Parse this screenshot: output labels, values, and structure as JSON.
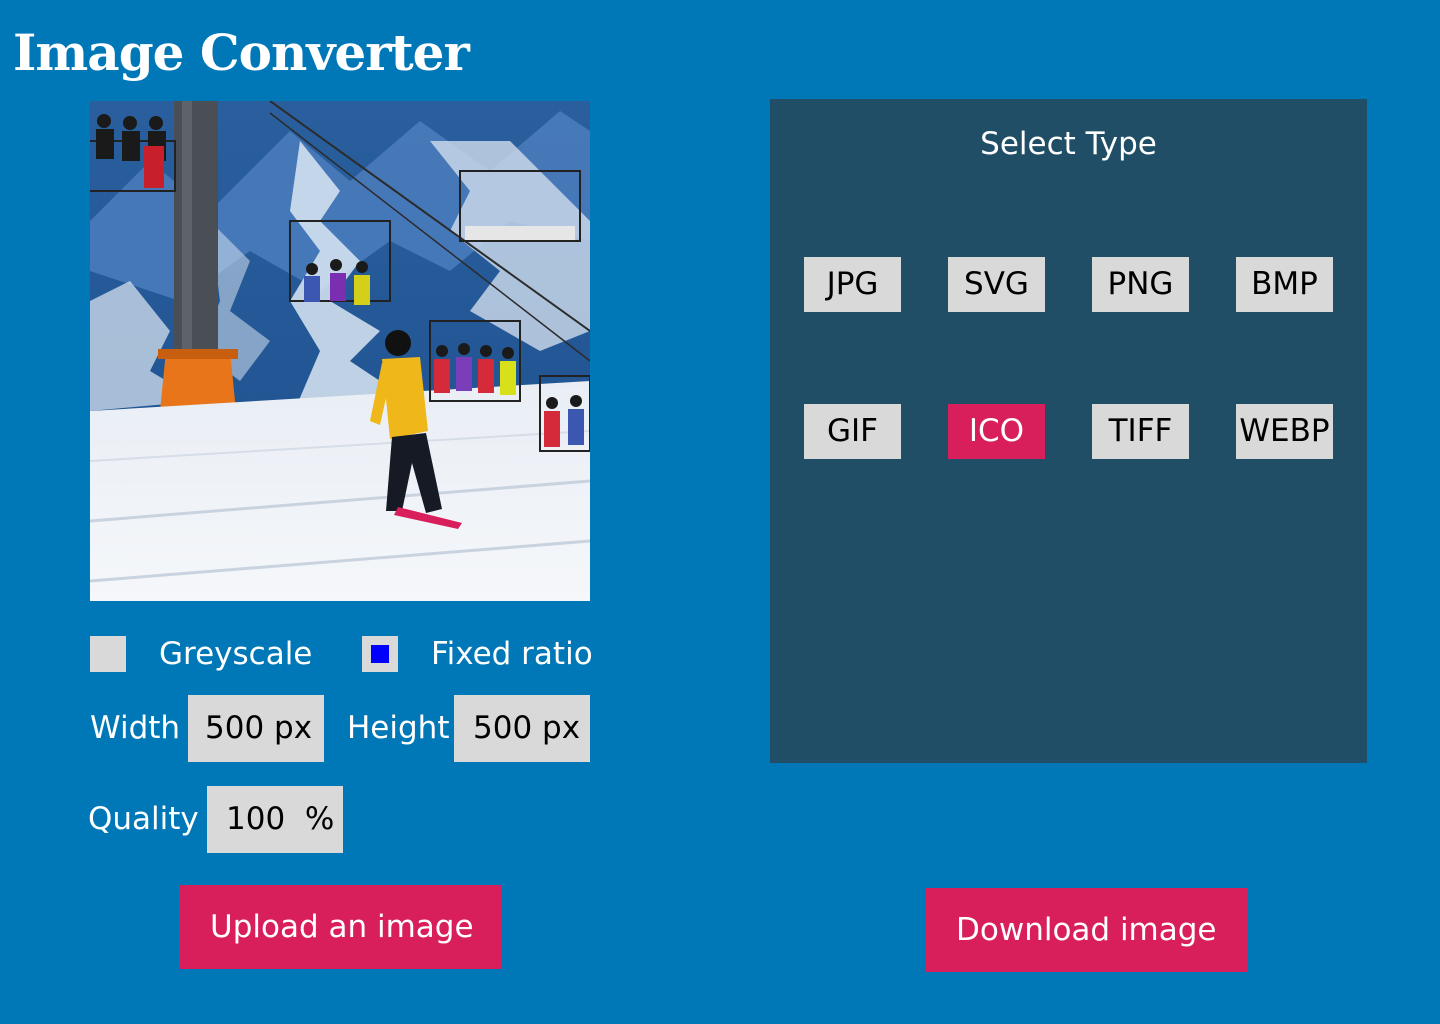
{
  "app": {
    "title": "Image Converter"
  },
  "options": {
    "greyscale_label": "Greyscale",
    "greyscale_checked": false,
    "fixed_ratio_label": "Fixed ratio",
    "fixed_ratio_checked": true
  },
  "dimensions": {
    "width_label": "Width",
    "width_value": "500 px",
    "height_label": "Height",
    "height_value": "500 px"
  },
  "quality": {
    "label": "Quality",
    "value": "100  %"
  },
  "actions": {
    "upload_label": "Upload an image",
    "download_label": "Download image"
  },
  "type_panel": {
    "title": "Select Type",
    "types": [
      "JPG",
      "SVG",
      "PNG",
      "BMP",
      "GIF",
      "ICO",
      "TIFF",
      "WEBP"
    ],
    "selected": "ICO"
  },
  "colors": {
    "background": "#0077b6",
    "panel": "#1f4e66",
    "accent": "#d81e5b",
    "control": "#d9d9d9",
    "checkbox_fill": "#0000ff"
  }
}
